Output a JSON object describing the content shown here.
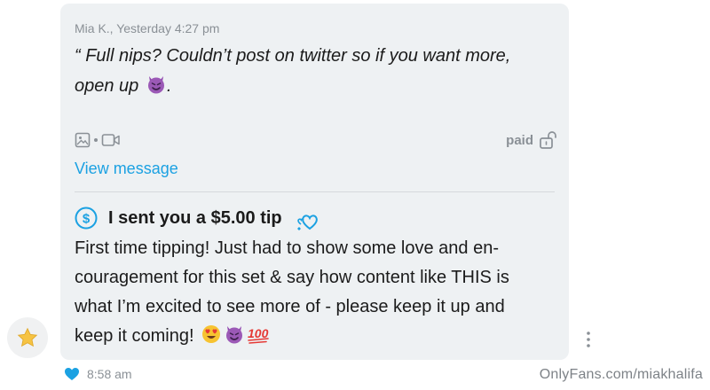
{
  "quoted_message": {
    "meta": "Mia K., Yesterday 4:27 pm",
    "text_line1": "“ Full nips? Couldn’t post on twitter so if you want more,",
    "text_line2": "open up",
    "text_line2_end": ".",
    "emoji": "smiling-devil-icon",
    "media_icons": [
      "image-icon",
      "video-icon"
    ],
    "price_label": "paid",
    "lock_icon": "unlocked-icon",
    "view_link": "View message"
  },
  "tip": {
    "icon": "dollar-circle-icon",
    "title": "I sent you a $5.00 tip",
    "heart_icon": "heart-sparkle-icon",
    "body_lines": [
      "First time tipping! Just had to show some love and en-",
      "couragement for this set & say how content like THIS is",
      "what I’m excited to see more of - please keep it up and",
      "keep it coming!"
    ],
    "trailing_emojis": [
      "heart-eyes-icon",
      "smiling-devil-icon",
      "hundred-points-icon"
    ]
  },
  "footer": {
    "time": "8:58 am",
    "liked_icon": "heart-icon",
    "watermark": "OnlyFans.com/miakhalifa"
  },
  "colors": {
    "accent": "#1ba1e2",
    "bubble_bg": "#eef1f3",
    "muted_text": "#8a9096"
  }
}
